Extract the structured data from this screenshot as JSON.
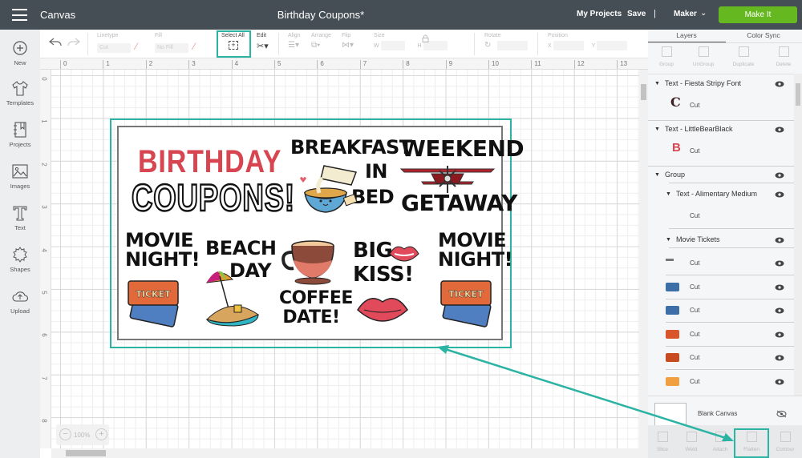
{
  "header": {
    "app_title": "Canvas",
    "document_title": "Birthday Coupons*",
    "my_projects": "My Projects",
    "save": "Save",
    "separator": "|",
    "machine": "Maker",
    "make_it": "Make It"
  },
  "left_nav": {
    "items": [
      {
        "label": "New",
        "icon": "plus-circle-icon"
      },
      {
        "label": "Templates",
        "icon": "tshirt-icon"
      },
      {
        "label": "Projects",
        "icon": "notebook-icon"
      },
      {
        "label": "Images",
        "icon": "image-icon"
      },
      {
        "label": "Text",
        "icon": "text-t-icon"
      },
      {
        "label": "Shapes",
        "icon": "shapes-icon"
      },
      {
        "label": "Upload",
        "icon": "upload-cloud-icon"
      }
    ]
  },
  "toolbar": {
    "linetype_label": "Linetype",
    "linetype_value": "Cut",
    "fill_label": "Fill",
    "fill_value": "No Fill",
    "select_all_label": "Select All",
    "edit_label": "Edit",
    "align_label": "Align",
    "arrange_label": "Arrange",
    "flip_label": "Flip",
    "size_label": "Size",
    "size_w": "W",
    "size_h": "H",
    "rotate_label": "Rotate",
    "position_label": "Position",
    "position_x": "X",
    "position_y": "Y"
  },
  "rulers": {
    "horizontal": [
      "0",
      "1",
      "2",
      "3",
      "4",
      "5",
      "6",
      "7",
      "8",
      "9",
      "10",
      "11",
      "12",
      "13"
    ],
    "vertical": [
      "0",
      "1",
      "2",
      "3",
      "4",
      "5",
      "6",
      "7",
      "8"
    ]
  },
  "zoom": {
    "level": "100%",
    "minus": "−",
    "plus": "+"
  },
  "design": {
    "birthday": "BIRTHDAY",
    "coupons": "COUPONS!",
    "breakfast": [
      "BREAKFAST",
      "IN",
      "BED"
    ],
    "weekend": [
      "WEEKEND",
      "GETAWAY"
    ],
    "movie_night": [
      "MOVIE",
      "NIGHT!"
    ],
    "beach_day": [
      "BEACH",
      "DAY"
    ],
    "coffee_date": [
      "COFFEE",
      "DATE!"
    ],
    "big_kiss": [
      "BIG",
      "KISS!"
    ],
    "ticket_text": "TICKET",
    "colors": {
      "red": "#d64550",
      "black": "#111111",
      "ticket_orange": "#e2693a",
      "ticket_blue": "#4f7fc0"
    }
  },
  "right_panel": {
    "tabs": [
      "Layers",
      "Color Sync"
    ],
    "active_tab": "Layers",
    "tools": [
      "Group",
      "UnGroup",
      "Duplicate",
      "Delete"
    ],
    "layers": [
      {
        "name": "Text - Fiesta Stripy Font",
        "child": "Cut",
        "thumb": "C",
        "thumb_color": "#3a2020"
      },
      {
        "name": "Text - LittleBearBlack",
        "child": "Cut",
        "thumb": "B",
        "thumb_color": "#d64550"
      },
      {
        "name": "Group"
      },
      {
        "name": "Text - Alimentary Medium",
        "child": "Cut"
      },
      {
        "name": "Movie Tickets"
      },
      {
        "child": "Cut",
        "thumb_color": "#777777"
      },
      {
        "child": "Cut",
        "thumb_color": "#3c6ea8"
      },
      {
        "child": "Cut",
        "thumb_color": "#3c6ea8"
      },
      {
        "child": "Cut",
        "thumb_color": "#d9552a"
      },
      {
        "child": "Cut",
        "thumb_color": "#c84a1f"
      },
      {
        "child": "Cut",
        "thumb_color": "#f0a040"
      }
    ],
    "blank_canvas": "Blank Canvas",
    "bottom_tools": [
      "Slice",
      "Weld",
      "Attach",
      "Flatten",
      "Contour"
    ],
    "highlighted_tool": "Flatten"
  },
  "accent_color": "#2bb3a3",
  "make_it_color": "#66b821"
}
